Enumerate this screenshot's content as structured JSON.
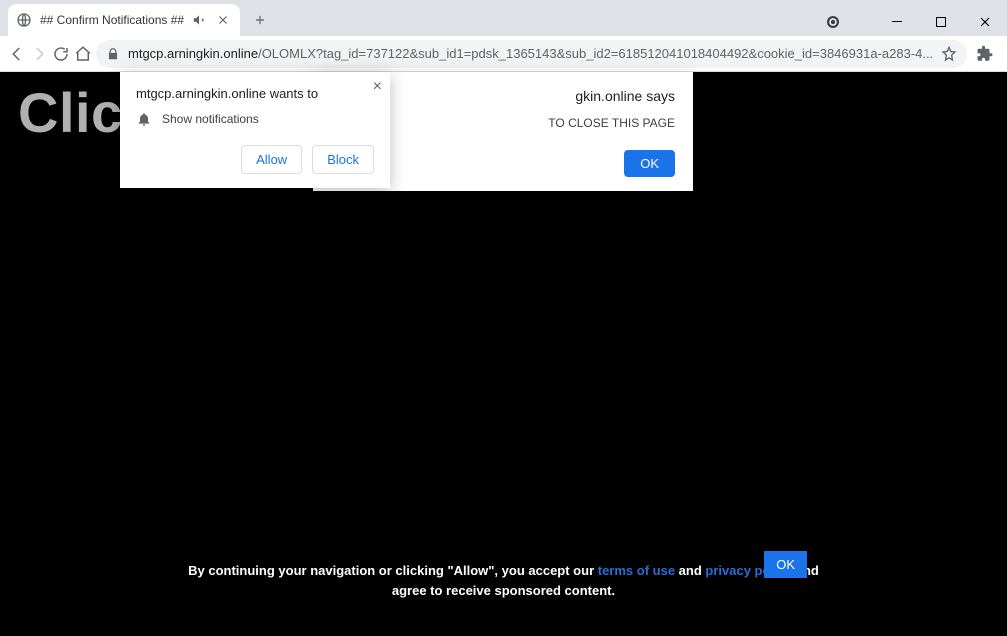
{
  "tab": {
    "title": "## Confirm Notifications ##"
  },
  "url": {
    "host": "mtgcp.arningkin.online",
    "path": "/OLOMLX?tag_id=737122&sub_id1=pdsk_1365143&sub_id2=618512041018404492&cookie_id=3846931a-a283-4..."
  },
  "page": {
    "headline_visible": "Clic                                   you are not a",
    "consent_pre": "By continuing your navigation or clicking \"Allow\", you accept our ",
    "terms": "terms of use",
    "consent_mid": " and ",
    "privacy": "privacy policy",
    "consent_post": " and",
    "consent_line2": "agree to receive sponsored content.",
    "ok": "OK"
  },
  "js_dialog": {
    "origin_suffix": "gkin.online says",
    "message_suffix": " TO CLOSE THIS PAGE",
    "ok": "OK"
  },
  "perm": {
    "origin": "mtgcp.arningkin.online wants to",
    "label": "Show notifications",
    "allow": "Allow",
    "block": "Block"
  }
}
